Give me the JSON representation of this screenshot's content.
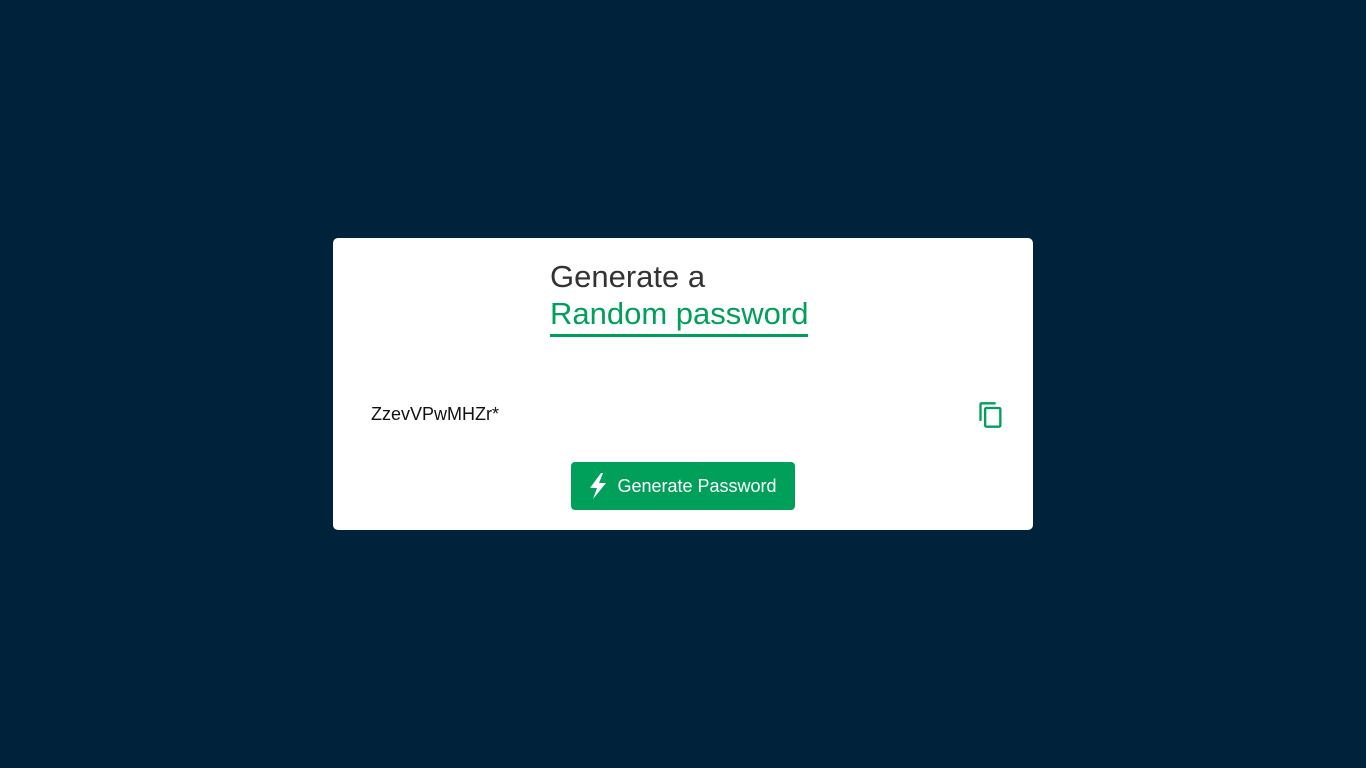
{
  "heading": {
    "line1": "Generate a",
    "line2": "Random password"
  },
  "password": {
    "value": "ZzevVPwMHZr*"
  },
  "actions": {
    "copy_icon": "copy-icon",
    "generate_icon": "bolt-icon",
    "generate_label": "Generate Password"
  },
  "colors": {
    "background": "#00223a",
    "card": "#ffffff",
    "accent": "#00a05a",
    "heading_text": "#333333"
  }
}
